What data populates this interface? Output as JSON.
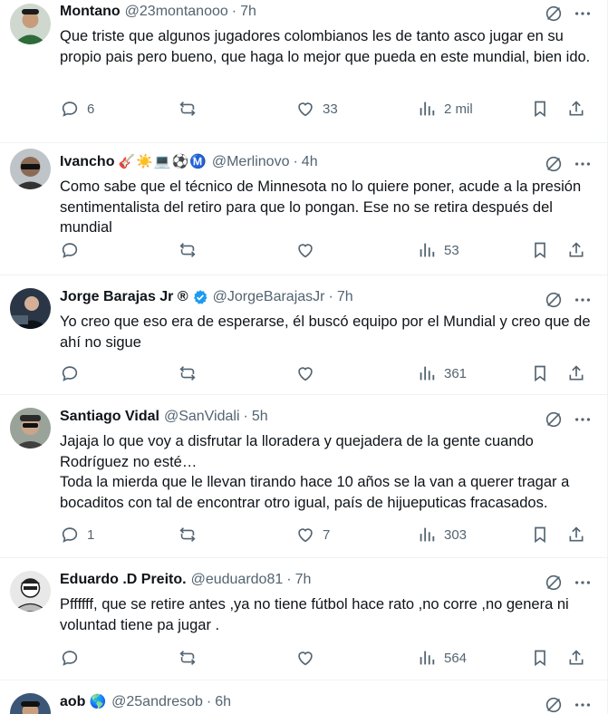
{
  "tweets": [
    {
      "name": "Montano",
      "emojis": "",
      "verified": false,
      "handle": "@23montanooo",
      "time": "7h",
      "text": "Que triste que algunos jugadores colombianos les de tanto asco jugar en su propio pais pero bueno, que haga lo mejor que pueda en este mundial, bien ido.",
      "replies": "6",
      "retweets": "",
      "likes": "33",
      "views": "2 mil",
      "avatar_color": "#3b6b3f"
    },
    {
      "name": "Ivancho",
      "emojis": "🎸☀️💻⚽Ⓜ️",
      "verified": false,
      "handle": "@Merlinovo",
      "time": "4h",
      "text": "Como sabe que el técnico de Minnesota no lo quiere poner, acude a la presión sentimentalista del retiro para que lo pongan. Ese no se retira después del mundial",
      "replies": "",
      "retweets": "",
      "likes": "",
      "views": "53",
      "avatar_color": "#4a4a4a"
    },
    {
      "name": "Jorge Barajas Jr ®",
      "emojis": "",
      "verified": true,
      "handle": "@JorgeBarajasJr",
      "time": "7h",
      "text": "Yo creo que eso era de esperarse, él buscó equipo por el Mundial y creo que de ahí no sigue",
      "replies": "",
      "retweets": "",
      "likes": "",
      "views": "361",
      "avatar_color": "#1f2a36"
    },
    {
      "name": "Santiago Vidal",
      "emojis": "",
      "verified": false,
      "handle": "@SanVidali",
      "time": "5h",
      "text": "Jajaja lo que voy a disfrutar la lloradera y quejadera de la gente cuando Rodríguez no esté…\nToda la mierda que le llevan tirando hace 10 años se la van a querer tragar a bocaditos con tal de encontrar otro igual, país de hijueputicas fracasados.",
      "replies": "1",
      "retweets": "",
      "likes": "7",
      "views": "303",
      "avatar_color": "#6d6a5e"
    },
    {
      "name": "Eduardo .D Preito.",
      "emojis": "",
      "verified": false,
      "handle": "@euduardo81",
      "time": "7h",
      "text": "Pffffff, que se retire antes ,ya no tiene fútbol hace rato ,no corre ,no genera ni voluntad tiene pa jugar .",
      "replies": "",
      "retweets": "",
      "likes": "",
      "views": "564",
      "avatar_color": "#d9d9d9"
    },
    {
      "name": "aob",
      "emojis": "🌎",
      "verified": false,
      "handle": "@25andresob",
      "time": "6h",
      "text": "",
      "replies": "",
      "retweets": "",
      "likes": "",
      "views": "",
      "avatar_color": "#2b3f5c"
    }
  ],
  "colors": {
    "muted": "#536471",
    "text": "#0f1419",
    "verified": "#1d9bf0",
    "divider": "#eff3f4"
  },
  "icons": {
    "reply": "reply-icon",
    "retweet": "retweet-icon",
    "like": "heart-icon",
    "views": "views-icon",
    "bookmark": "bookmark-icon",
    "share": "share-icon",
    "grok": "grok-icon",
    "more": "more-icon"
  }
}
